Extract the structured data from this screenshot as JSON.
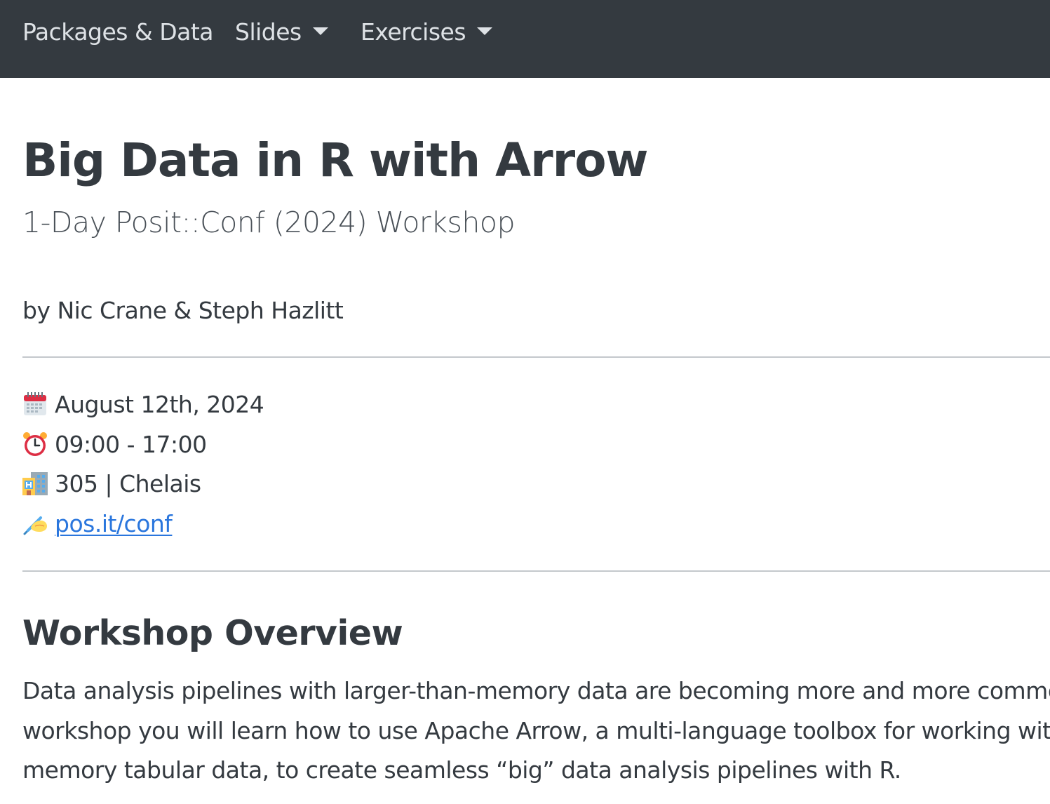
{
  "navbar": {
    "items": [
      {
        "label": "Packages & Data",
        "has_dropdown": false
      },
      {
        "label": "Slides",
        "has_dropdown": true
      },
      {
        "label": "Exercises",
        "has_dropdown": true
      }
    ],
    "background": "#343a40"
  },
  "header": {
    "title": "Big Data in R with Arrow",
    "subtitle": "1-Day Posit::Conf (2024) Workshop",
    "author": "by Nic Crane & Steph Hazlitt"
  },
  "info": {
    "date": {
      "icon": "calendar-icon",
      "text": "August 12th, 2024"
    },
    "time": {
      "icon": "alarm-clock-icon",
      "text": "09:00 - 17:00"
    },
    "room": {
      "icon": "hotel-building-icon",
      "text": "305 | Chelais"
    },
    "link": {
      "icon": "writing-hand-icon",
      "text": "pos.it/conf"
    }
  },
  "overview": {
    "heading": "Workshop Overview",
    "lines": [
      "Data analysis pipelines with larger-than-memory data are becoming more and more common",
      "workshop you will learn how to use Apache Arrow, a multi-language toolbox for working with l",
      "memory tabular data, to create seamless “big” data analysis pipelines with R."
    ]
  },
  "colors": {
    "link": "#2a76dd",
    "text": "#343a40",
    "nav_text": "#dee2e6"
  }
}
